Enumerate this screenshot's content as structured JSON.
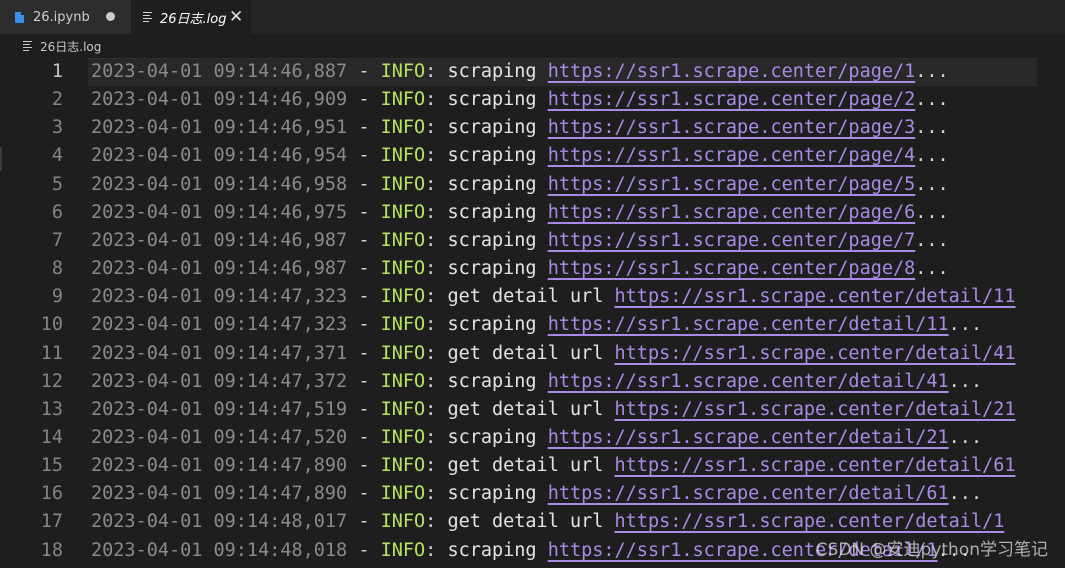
{
  "tabs": [
    {
      "label": "26.ipynb",
      "icon": "notebook-file-icon",
      "dirty": true
    },
    {
      "label": "26日志.log",
      "icon": "text-file-icon",
      "active": true
    }
  ],
  "breadcrumb": {
    "file": "26日志.log"
  },
  "lines": [
    {
      "num": "1",
      "ts": "2023-04-01 09:14:46,887",
      "level": "INFO",
      "msg": "scraping",
      "url": "https://ssr1.scrape.center/page/1",
      "suffix": "..."
    },
    {
      "num": "2",
      "ts": "2023-04-01 09:14:46,909",
      "level": "INFO",
      "msg": "scraping",
      "url": "https://ssr1.scrape.center/page/2",
      "suffix": "..."
    },
    {
      "num": "3",
      "ts": "2023-04-01 09:14:46,951",
      "level": "INFO",
      "msg": "scraping",
      "url": "https://ssr1.scrape.center/page/3",
      "suffix": "..."
    },
    {
      "num": "4",
      "ts": "2023-04-01 09:14:46,954",
      "level": "INFO",
      "msg": "scraping",
      "url": "https://ssr1.scrape.center/page/4",
      "suffix": "..."
    },
    {
      "num": "5",
      "ts": "2023-04-01 09:14:46,958",
      "level": "INFO",
      "msg": "scraping",
      "url": "https://ssr1.scrape.center/page/5",
      "suffix": "..."
    },
    {
      "num": "6",
      "ts": "2023-04-01 09:14:46,975",
      "level": "INFO",
      "msg": "scraping",
      "url": "https://ssr1.scrape.center/page/6",
      "suffix": "..."
    },
    {
      "num": "7",
      "ts": "2023-04-01 09:14:46,987",
      "level": "INFO",
      "msg": "scraping",
      "url": "https://ssr1.scrape.center/page/7",
      "suffix": "..."
    },
    {
      "num": "8",
      "ts": "2023-04-01 09:14:46,987",
      "level": "INFO",
      "msg": "scraping",
      "url": "https://ssr1.scrape.center/page/8",
      "suffix": "..."
    },
    {
      "num": "9",
      "ts": "2023-04-01 09:14:47,323",
      "level": "INFO",
      "msg": "get detail url",
      "url": "https://ssr1.scrape.center/detail/11",
      "suffix": ""
    },
    {
      "num": "10",
      "ts": "2023-04-01 09:14:47,323",
      "level": "INFO",
      "msg": "scraping",
      "url": "https://ssr1.scrape.center/detail/11",
      "suffix": "..."
    },
    {
      "num": "11",
      "ts": "2023-04-01 09:14:47,371",
      "level": "INFO",
      "msg": "get detail url",
      "url": "https://ssr1.scrape.center/detail/41",
      "suffix": ""
    },
    {
      "num": "12",
      "ts": "2023-04-01 09:14:47,372",
      "level": "INFO",
      "msg": "scraping",
      "url": "https://ssr1.scrape.center/detail/41",
      "suffix": "..."
    },
    {
      "num": "13",
      "ts": "2023-04-01 09:14:47,519",
      "level": "INFO",
      "msg": "get detail url",
      "url": "https://ssr1.scrape.center/detail/21",
      "suffix": ""
    },
    {
      "num": "14",
      "ts": "2023-04-01 09:14:47,520",
      "level": "INFO",
      "msg": "scraping",
      "url": "https://ssr1.scrape.center/detail/21",
      "suffix": "..."
    },
    {
      "num": "15",
      "ts": "2023-04-01 09:14:47,890",
      "level": "INFO",
      "msg": "get detail url",
      "url": "https://ssr1.scrape.center/detail/61",
      "suffix": ""
    },
    {
      "num": "16",
      "ts": "2023-04-01 09:14:47,890",
      "level": "INFO",
      "msg": "scraping",
      "url": "https://ssr1.scrape.center/detail/61",
      "suffix": "..."
    },
    {
      "num": "17",
      "ts": "2023-04-01 09:14:48,017",
      "level": "INFO",
      "msg": "get detail url",
      "url": "https://ssr1.scrape.center/detail/1",
      "suffix": ""
    },
    {
      "num": "18",
      "ts": "2023-04-01 09:14:48,018",
      "level": "INFO",
      "msg": "scraping",
      "url": "https://ssr1.scrape.center/detail/1",
      "suffix": "..."
    }
  ],
  "current_line": "1",
  "watermark": "CSDN @安迪python学习笔记",
  "colors": {
    "background": "#1e1e1e",
    "level": "#b5e45f",
    "url": "#a98ae4",
    "timestamp": "#8a8a8a"
  }
}
